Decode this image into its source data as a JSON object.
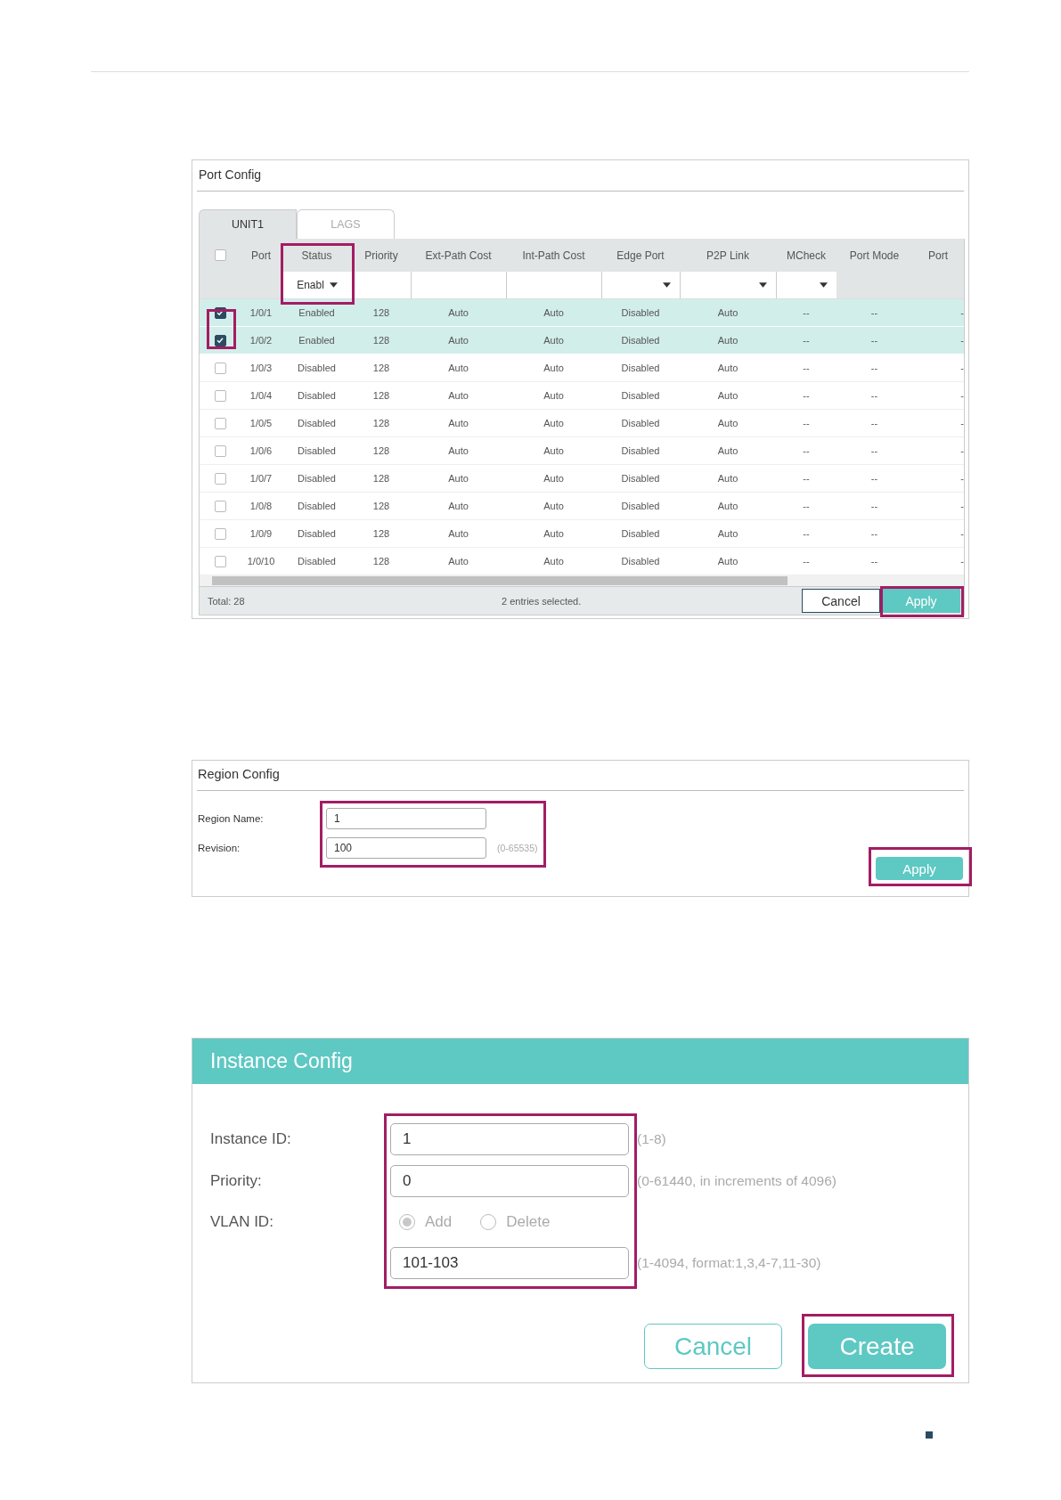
{
  "port_config": {
    "title": "Port Config",
    "tabs": [
      {
        "label": "UNIT1",
        "selected": true
      },
      {
        "label": "LAGS",
        "selected": false
      }
    ],
    "table": {
      "select_all_checked": false,
      "highlight_checked": true,
      "columns": [
        {
          "label": "Port",
          "highlighted": false
        },
        {
          "label": "Status",
          "filter": {
            "kind": "select",
            "value": "Enabl"
          },
          "highlighted": true
        },
        {
          "label": "Priority",
          "filter": {
            "kind": "input"
          },
          "highlighted": false
        },
        {
          "label": "Ext-Path Cost",
          "filter": {
            "kind": "input"
          },
          "highlighted": false
        },
        {
          "label": "Int-Path Cost",
          "filter": {
            "kind": "input"
          },
          "highlighted": false
        },
        {
          "label": "Edge Port",
          "filter": {
            "kind": "select"
          },
          "highlighted": false
        },
        {
          "label": "P2P Link",
          "filter": {
            "kind": "select"
          },
          "highlighted": false
        },
        {
          "label": "MCheck",
          "filter": {
            "kind": "select"
          },
          "highlighted": false
        },
        {
          "label": "Port Mode",
          "highlighted": false
        },
        {
          "label": "Port",
          "highlighted": false
        }
      ],
      "rows": [
        {
          "checked": true,
          "selected": true,
          "cells": [
            "1/0/1",
            "Enabled",
            "128",
            "Auto",
            "Auto",
            "Disabled",
            "Auto",
            "--",
            "--",
            "-"
          ]
        },
        {
          "checked": true,
          "selected": true,
          "cells": [
            "1/0/2",
            "Enabled",
            "128",
            "Auto",
            "Auto",
            "Disabled",
            "Auto",
            "--",
            "--",
            "-"
          ]
        },
        {
          "checked": false,
          "selected": false,
          "cells": [
            "1/0/3",
            "Disabled",
            "128",
            "Auto",
            "Auto",
            "Disabled",
            "Auto",
            "--",
            "--",
            "-"
          ]
        },
        {
          "checked": false,
          "selected": false,
          "cells": [
            "1/0/4",
            "Disabled",
            "128",
            "Auto",
            "Auto",
            "Disabled",
            "Auto",
            "--",
            "--",
            "-"
          ]
        },
        {
          "checked": false,
          "selected": false,
          "cells": [
            "1/0/5",
            "Disabled",
            "128",
            "Auto",
            "Auto",
            "Disabled",
            "Auto",
            "--",
            "--",
            "-"
          ]
        },
        {
          "checked": false,
          "selected": false,
          "cells": [
            "1/0/6",
            "Disabled",
            "128",
            "Auto",
            "Auto",
            "Disabled",
            "Auto",
            "--",
            "--",
            "-"
          ]
        },
        {
          "checked": false,
          "selected": false,
          "cells": [
            "1/0/7",
            "Disabled",
            "128",
            "Auto",
            "Auto",
            "Disabled",
            "Auto",
            "--",
            "--",
            "-"
          ]
        },
        {
          "checked": false,
          "selected": false,
          "cells": [
            "1/0/8",
            "Disabled",
            "128",
            "Auto",
            "Auto",
            "Disabled",
            "Auto",
            "--",
            "--",
            "-"
          ]
        },
        {
          "checked": false,
          "selected": false,
          "cells": [
            "1/0/9",
            "Disabled",
            "128",
            "Auto",
            "Auto",
            "Disabled",
            "Auto",
            "--",
            "--",
            "-"
          ]
        },
        {
          "checked": false,
          "selected": false,
          "cells": [
            "1/0/10",
            "Disabled",
            "128",
            "Auto",
            "Auto",
            "Disabled",
            "Auto",
            "--",
            "--",
            "-"
          ]
        }
      ]
    },
    "total": "Total: 28",
    "selection_note": "2 entries selected.",
    "buttons": [
      {
        "label": "Cancel",
        "kind": "secondary",
        "highlighted": false
      },
      {
        "label": "Apply",
        "kind": "primary",
        "highlighted": true
      }
    ]
  },
  "region_config": {
    "title": "Region Config",
    "fields_highlighted": true,
    "fields": [
      {
        "label": "Region Name:",
        "value": "1"
      },
      {
        "label": "Revision:",
        "value": "100",
        "hint": "(0-65535)"
      }
    ],
    "button": {
      "label": "Apply",
      "highlighted": true
    }
  },
  "instance_config": {
    "title": "Instance Config",
    "fields_highlighted": true,
    "rows": [
      {
        "kind": "input",
        "label": "Instance ID:",
        "value": "1",
        "hint": "(1-8)"
      },
      {
        "kind": "input",
        "label": "Priority:",
        "value": "0",
        "hint": "(0-61440, in increments of 4096)"
      },
      {
        "kind": "radio",
        "label": "VLAN ID:",
        "disabled": true,
        "options": [
          {
            "label": "Add",
            "selected": true
          },
          {
            "label": "Delete",
            "selected": false
          }
        ]
      },
      {
        "kind": "input",
        "value": "101-103",
        "hint": "(1-4094, format:1,3,4-7,11-30)"
      }
    ],
    "buttons": [
      {
        "label": "Cancel",
        "kind": "secondary",
        "highlighted": false
      },
      {
        "label": "Create",
        "kind": "primary",
        "highlighted": true
      }
    ]
  }
}
